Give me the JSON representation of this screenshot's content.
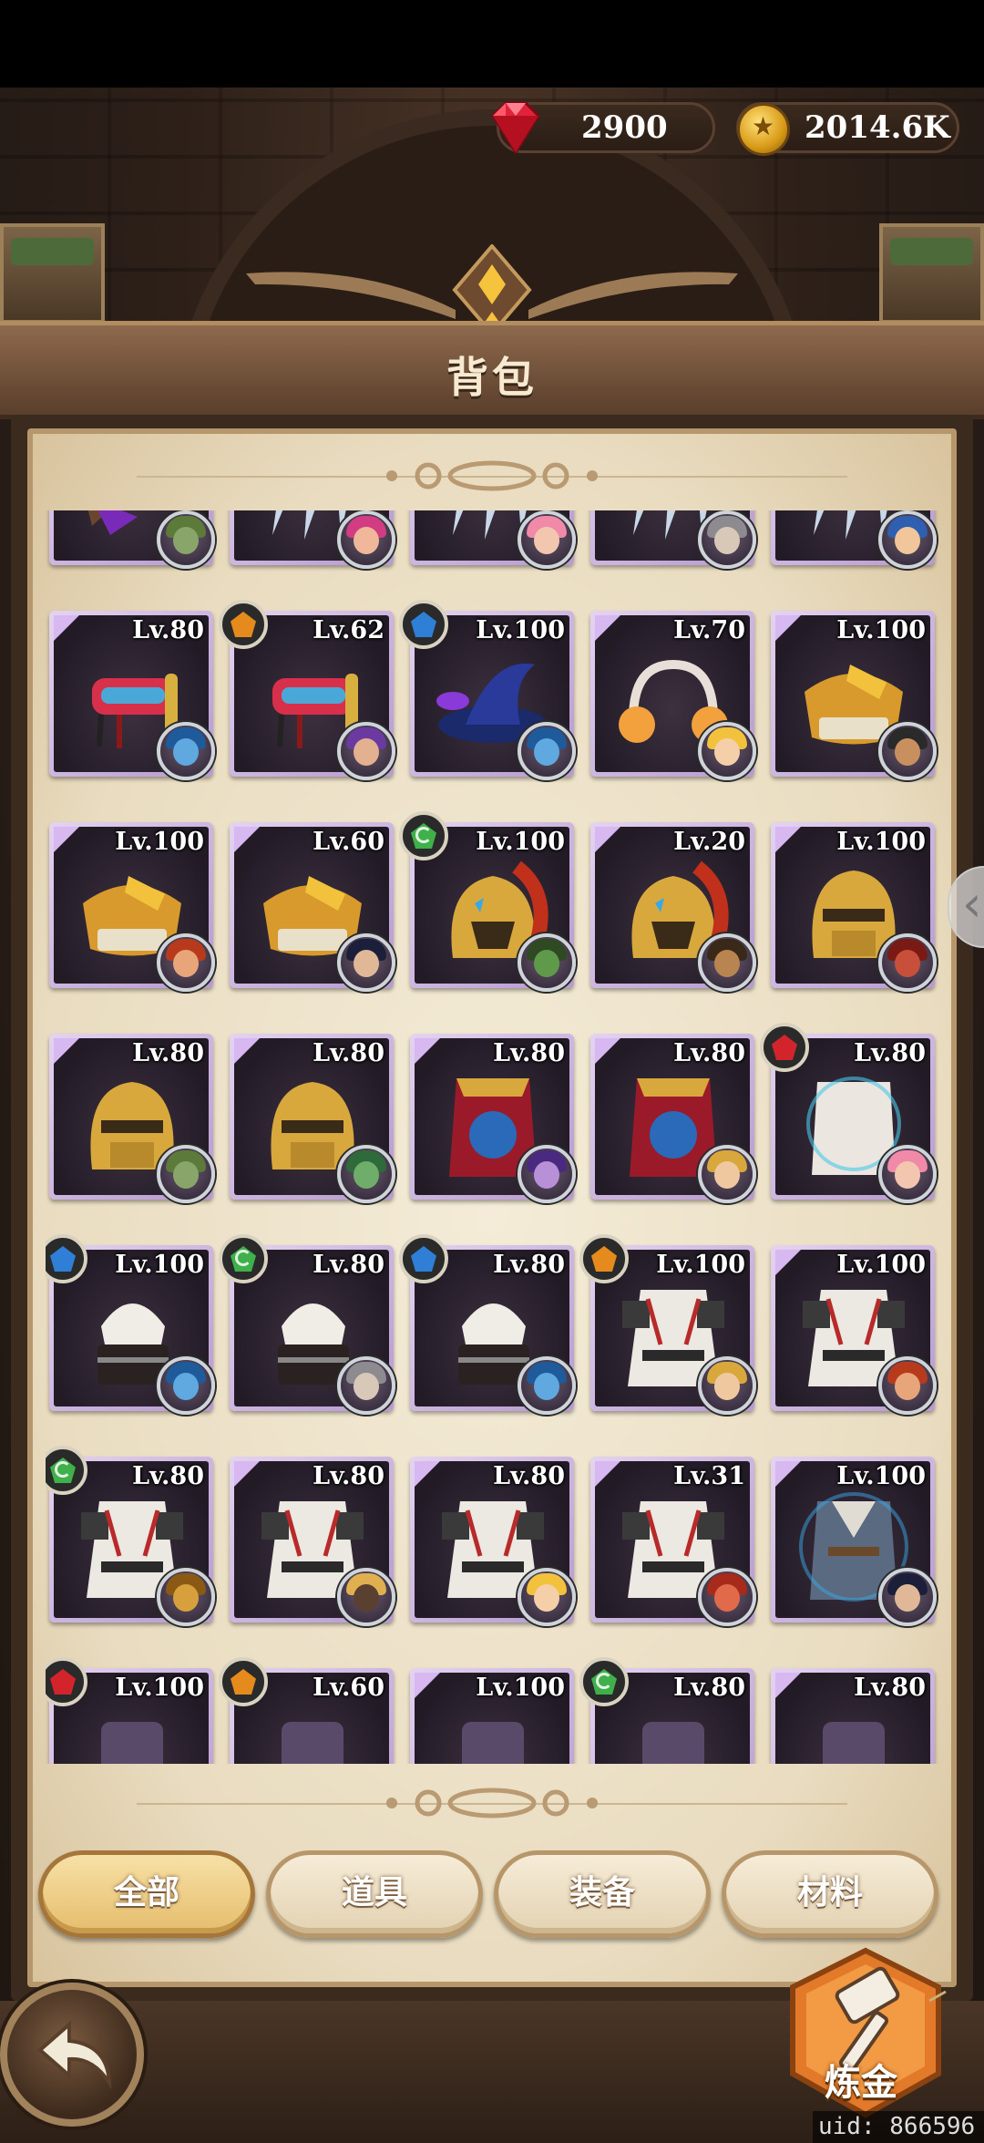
{
  "header": {
    "gems": "2900",
    "gold": "2014.6K"
  },
  "title": "背包",
  "tabs": [
    {
      "label": "全部",
      "active": true
    },
    {
      "label": "道具",
      "active": false
    },
    {
      "label": "装备",
      "active": false
    },
    {
      "label": "材料",
      "active": false
    }
  ],
  "alchemy_label": "炼金",
  "uid": "uid: 866596",
  "colors": {
    "rune_blue": "#2f7fd6",
    "rune_green": "#3fb04a",
    "rune_orange": "#e58a1c",
    "rune_red": "#d3242c",
    "frame_purple": "#b69ad0"
  },
  "items": [
    {
      "level": "",
      "art": "crossbow",
      "rune": null,
      "hero": "goblin"
    },
    {
      "level": "",
      "art": "claws",
      "rune": null,
      "hero": "pink-hair"
    },
    {
      "level": "",
      "art": "claws",
      "rune": null,
      "hero": "pink-girl"
    },
    {
      "level": "",
      "art": "claws",
      "rune": null,
      "hero": "grey-elf"
    },
    {
      "level": "",
      "art": "claws",
      "rune": null,
      "hero": "blue-knight"
    },
    {
      "level": "Lv.80",
      "art": "mask",
      "rune": null,
      "hero": "blue-imp"
    },
    {
      "level": "Lv.62",
      "art": "mask",
      "rune": "orange",
      "hero": "purple-mage"
    },
    {
      "level": "Lv.100",
      "art": "wizard-hat",
      "rune": "blue",
      "hero": "blue-imp"
    },
    {
      "level": "Lv.70",
      "art": "headphones",
      "rune": null,
      "hero": "blonde-girl"
    },
    {
      "level": "Lv.100",
      "art": "skull-mask",
      "rune": null,
      "hero": "dark-warrior"
    },
    {
      "level": "Lv.100",
      "art": "skull-mask",
      "rune": null,
      "hero": "red-hair"
    },
    {
      "level": "Lv.60",
      "art": "skull-mask",
      "rune": null,
      "hero": "dark-mage"
    },
    {
      "level": "Lv.100",
      "art": "gold-helm",
      "rune": "green",
      "hero": "green-orc"
    },
    {
      "level": "Lv.20",
      "art": "gold-helm",
      "rune": null,
      "hero": "brown-man"
    },
    {
      "level": "Lv.100",
      "art": "gold-visor",
      "rune": null,
      "hero": "red-beast"
    },
    {
      "level": "Lv.80",
      "art": "gold-visor",
      "rune": null,
      "hero": "goblin"
    },
    {
      "level": "Lv.80",
      "art": "gold-visor",
      "rune": null,
      "hero": "green-lizard"
    },
    {
      "level": "Lv.80",
      "art": "red-armor",
      "rune": null,
      "hero": "purple-elf"
    },
    {
      "level": "Lv.80",
      "art": "red-armor",
      "rune": null,
      "hero": "blonde-knight"
    },
    {
      "level": "Lv.80",
      "art": "white-vest",
      "rune": "red",
      "hero": "pink-girl"
    },
    {
      "level": "Lv.100",
      "art": "white-hood",
      "rune": "blue",
      "hero": "blue-imp"
    },
    {
      "level": "Lv.80",
      "art": "white-hood",
      "rune": "green",
      "hero": "grey-elf"
    },
    {
      "level": "Lv.80",
      "art": "white-hood",
      "rune": "blue",
      "hero": "blue-imp"
    },
    {
      "level": "Lv.100",
      "art": "white-robe",
      "rune": "orange",
      "hero": "blonde-knight"
    },
    {
      "level": "Lv.100",
      "art": "white-robe",
      "rune": null,
      "hero": "red-hair"
    },
    {
      "level": "Lv.80",
      "art": "white-robe",
      "rune": "green",
      "hero": "lion"
    },
    {
      "level": "Lv.80",
      "art": "white-robe",
      "rune": null,
      "hero": "dark-beast"
    },
    {
      "level": "Lv.80",
      "art": "white-robe",
      "rune": null,
      "hero": "blonde-girl"
    },
    {
      "level": "Lv.31",
      "art": "white-robe",
      "rune": null,
      "hero": "red-fox"
    },
    {
      "level": "Lv.100",
      "art": "coat",
      "rune": null,
      "hero": "dark-mage"
    },
    {
      "level": "Lv.100",
      "art": "misc",
      "rune": "red",
      "hero": ""
    },
    {
      "level": "Lv.60",
      "art": "misc",
      "rune": "orange",
      "hero": ""
    },
    {
      "level": "Lv.100",
      "art": "misc",
      "rune": null,
      "hero": ""
    },
    {
      "level": "Lv.80",
      "art": "misc",
      "rune": "green",
      "hero": ""
    },
    {
      "level": "Lv.80",
      "art": "misc",
      "rune": null,
      "hero": ""
    }
  ]
}
